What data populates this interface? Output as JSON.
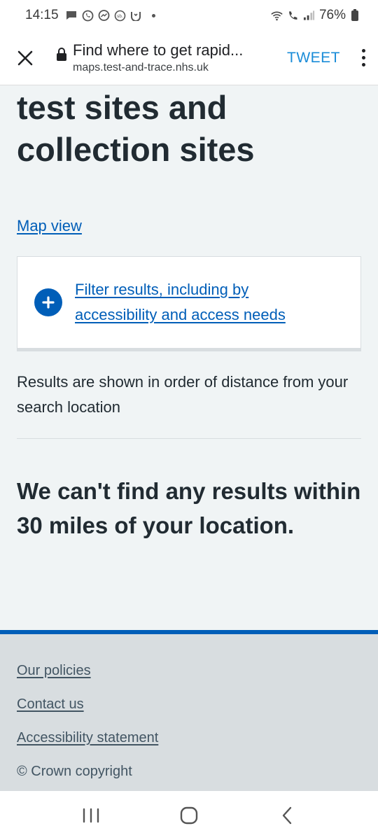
{
  "status_bar": {
    "time": "14:15",
    "battery": "76%",
    "notification_icons": [
      "message-icon",
      "whatsapp-icon",
      "messenger-icon",
      "sb-icon",
      "app-icon"
    ],
    "system_icons": [
      "wifi-icon",
      "call-icon",
      "signal-icon",
      "battery-icon"
    ]
  },
  "browser": {
    "page_title": "Find where to get rapid...",
    "url": "maps.test-and-trace.nhs.uk",
    "tweet_label": "TWEET"
  },
  "main": {
    "heading_line1": "test sites and",
    "heading_line2": "collection sites",
    "map_view_label": "Map view",
    "filter_line1": "Filter results, including by",
    "filter_line2": "accessibility and access needs",
    "results_note": "Results are shown in order of distance from your search location",
    "no_results_message": "We can't find any results within 30 miles of your location."
  },
  "footer": {
    "links": [
      "Our policies",
      "Contact us",
      "Accessibility statement"
    ],
    "copyright": "© Crown copyright"
  },
  "colors": {
    "nhs_blue": "#005eb8",
    "page_background": "#f0f4f5",
    "footer_background": "#d8dde0",
    "text_primary": "#212b32",
    "tweet_blue": "#1a8cd8"
  }
}
